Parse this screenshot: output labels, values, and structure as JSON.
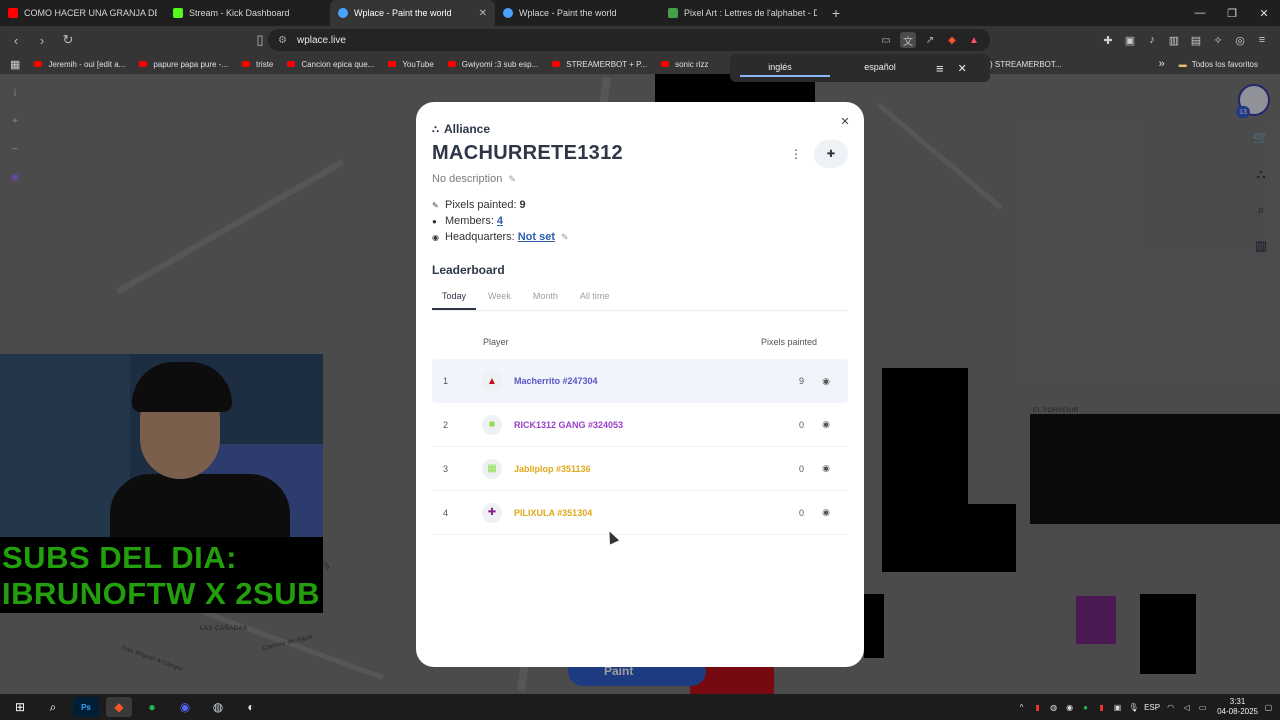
{
  "browser": {
    "tabs": [
      {
        "title": "COMO HACER UNA GRANJA DE PLA",
        "color": "#ff0000",
        "active": false,
        "closable": false
      },
      {
        "title": "Stream - Kick Dashboard",
        "color": "#53fc18",
        "active": false,
        "closable": false
      },
      {
        "title": "Wplace - Paint the world",
        "color": "#4aa3ff",
        "active": true,
        "closable": true
      },
      {
        "title": "Wplace - Paint the world",
        "color": "#4aa3ff",
        "active": false,
        "closable": false
      },
      {
        "title": "Pixel Art : Lettres de l'alphabet - Doc",
        "color": "#43a047",
        "active": false,
        "closable": false
      }
    ],
    "url": "wplace.live",
    "bookmarks": [
      "Jeremih - oui [edit a...",
      "papure papa pure -...",
      "triste",
      "Cancion epica que...",
      "YouTube",
      "Gwiyomi :3 sub esp...",
      "STREAMERBOT + P...",
      "sonic rizz"
    ],
    "bookmark_hidden": ") STREAMERBOT...",
    "bookmark_folder": "Todos los favoritos",
    "translate": {
      "lang_a": "inglés",
      "lang_b": "español"
    }
  },
  "overlay": {
    "subs_line1": "SUBS DEL DIA:",
    "subs_line2": "IBRUNOFTW X 2SUB"
  },
  "map": {
    "labels": [
      "EL PORVENIR",
      "LAS CAÑADAS",
      "Camino de Agua",
      "La Cañada",
      "San Miguel Arcángel"
    ],
    "paint_label": "Paint",
    "avatar_badge": "13"
  },
  "modal": {
    "section": "Alliance",
    "name": "MACHURRETE1312",
    "description": "No description",
    "stats": {
      "pixels_label": "Pixels painted:",
      "pixels_value": "9",
      "members_label": "Members:",
      "members_value": "4",
      "hq_label": "Headquarters:",
      "hq_value": "Not set"
    },
    "leaderboard_title": "Leaderboard",
    "tabs": [
      "Today",
      "Week",
      "Month",
      "All time"
    ],
    "col_player": "Player",
    "col_pixels": "Pixels painted",
    "rows": [
      {
        "rank": "1",
        "name": "Macherrito #247304",
        "pixels": "9",
        "color": "#5a55c8",
        "avatar": "#c0101a"
      },
      {
        "rank": "2",
        "name": "RICK1312 GANG #324053",
        "pixels": "0",
        "color": "#9b3fc9",
        "avatar": "#8be04a"
      },
      {
        "rank": "3",
        "name": "Jabliplop #351136",
        "pixels": "0",
        "color": "#e0a81c",
        "avatar": "#8be04a"
      },
      {
        "rank": "4",
        "name": "PILIXULA #351304",
        "pixels": "0",
        "color": "#e0a81c",
        "avatar": "#8a1c8a"
      }
    ]
  },
  "taskbar": {
    "lang": "ESP",
    "time": "3:31",
    "date": "04-08-2025"
  }
}
